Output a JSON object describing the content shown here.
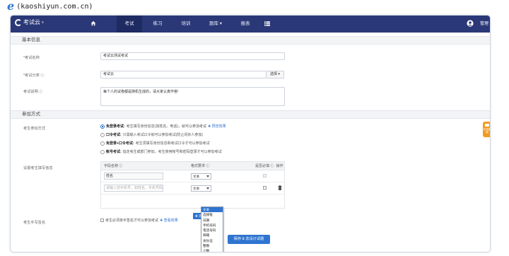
{
  "watermark": {
    "logo_letter": "e",
    "text": "(kaoshiyun.com.cn)"
  },
  "colors": {
    "nav_bg": "#2a3877",
    "accent": "#2f74d0",
    "side_tab": "#f29b21"
  },
  "topnav": {
    "brand": "考试云",
    "brand_mark": "®",
    "items": [
      {
        "label": "",
        "icon": "home-icon"
      },
      {
        "label": "考试",
        "active": true
      },
      {
        "label": "练习"
      },
      {
        "label": "培训"
      },
      {
        "label": "题库 ▾"
      },
      {
        "label": "报表"
      },
      {
        "label": "",
        "icon": "menu-icon"
      }
    ],
    "user_icon": "user-icon",
    "user_label": "管理"
  },
  "basic_section": {
    "title": "基本信息",
    "name_label": "*考试名称",
    "name_value": "考试云测试考试",
    "category_label": "*考试分类 ⓘ",
    "category_value": "考试云",
    "category_button": "选择 ▾",
    "desc_label": "考试说明 ⓘ",
    "desc_value": "每个人的试卷都是随机生成的，请大家认真作答!"
  },
  "join_section": {
    "title": "参加方式",
    "mode_label": "考生参加方式",
    "options": [
      {
        "name": "免登录考试:",
        "desc": "考生填写身份信息(如姓名、电话)，就可以参加考试",
        "link": "✚ 预览效果",
        "checked": true
      },
      {
        "name": "口令考试:",
        "desc": "只需输入考试口令就可以参加考试(防止闲杂人参加)",
        "link": "",
        "checked": false
      },
      {
        "name": "免登录+口令考试:",
        "desc": "考生须填写身份信息和考试口令才可以参加考试",
        "link": "",
        "checked": false
      },
      {
        "name": "帐号考试:",
        "desc": "指定考生或部门参加，考生使用帐号和密码登录才可以参加考试",
        "link": "",
        "checked": false
      }
    ],
    "fields_label": "设置考生填写信息",
    "table": {
      "headers": [
        "字段名称 ⓘ",
        "格式要求 ⓘ",
        "是否必填 ⓘ",
        "操作"
      ],
      "rows": [
        {
          "name": "姓名",
          "format": "文本"
        },
        {
          "name": "",
          "placeholder": "请输入您手机号，如姓名、手机号码",
          "format": "文本"
        }
      ]
    },
    "format_options": [
      "文本",
      "选择框",
      "日期",
      "手机号码",
      "电话号码",
      "邮箱",
      "身份证",
      "整数",
      "小数"
    ],
    "add_button": "✚ 添",
    "signature_label": "考生手写签名",
    "signature_text": "考生必须亲手签名才可以参加考试",
    "signature_link": "✚ 查看效果"
  },
  "save_button": "保存 & 去设计试题",
  "side_tab": "在线客服"
}
